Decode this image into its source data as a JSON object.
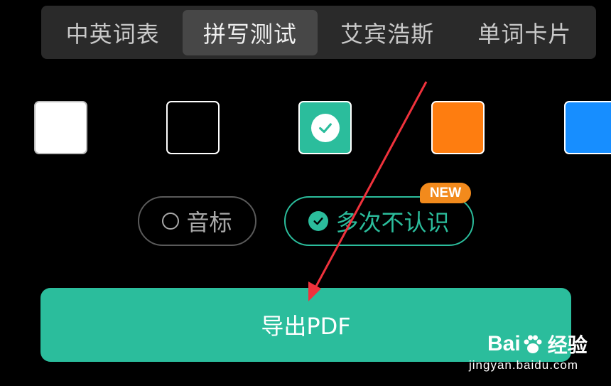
{
  "tabs": [
    {
      "label": "中英词表",
      "active": false
    },
    {
      "label": "拼写测试",
      "active": true
    },
    {
      "label": "艾宾浩斯",
      "active": false
    },
    {
      "label": "单词卡片",
      "active": false
    }
  ],
  "colors": [
    {
      "name": "white",
      "hex": "#ffffff",
      "selected": false
    },
    {
      "name": "black",
      "hex": "#000000",
      "selected": false
    },
    {
      "name": "green",
      "hex": "#2bbd9c",
      "selected": true
    },
    {
      "name": "orange",
      "hex": "#fe7d10",
      "selected": false
    },
    {
      "name": "blue",
      "hex": "#178eff",
      "selected": false
    }
  ],
  "options": {
    "phonetic": {
      "label": "音标",
      "checked": false
    },
    "multiple_unknown": {
      "label": "多次不认识",
      "checked": true,
      "badge": "NEW"
    }
  },
  "export_button": {
    "label": "导出PDF"
  },
  "watermark": {
    "logo": "Bai du 经验",
    "url": "jingyan.baidu.com"
  },
  "accent_color": "#2bbd9c",
  "annotation_color": "#f0323c"
}
